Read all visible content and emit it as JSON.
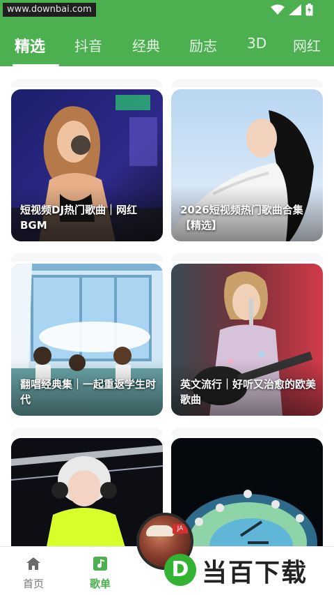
{
  "status_bar": {
    "watermark_url": "www.downbai.com",
    "icons": [
      "wifi-icon",
      "signal-icon",
      "battery-charging-icon"
    ]
  },
  "tabs": [
    {
      "label": "精选",
      "active": true
    },
    {
      "label": "抖音",
      "active": false
    },
    {
      "label": "经典",
      "active": false
    },
    {
      "label": "励志",
      "active": false
    },
    {
      "label": "3D",
      "active": false
    },
    {
      "label": "网红",
      "active": false
    }
  ],
  "cards": [
    {
      "title": "短视频DJ热门歌曲｜网红BGM"
    },
    {
      "title": "2026短视频热门歌曲合集【精选】"
    },
    {
      "title": "翻唱经典集｜一起重返学生时代"
    },
    {
      "title": "英文流行｜好听又治愈的欧美歌曲"
    },
    {
      "title": ""
    },
    {
      "title": ""
    }
  ],
  "bottom_nav": [
    {
      "label": "首页",
      "icon": "home-icon",
      "active": false
    },
    {
      "label": "歌单",
      "icon": "music-note-icon",
      "active": true
    }
  ],
  "mini_player": {
    "tag": "JA"
  },
  "brand": {
    "letter": "D",
    "text": "当百下载"
  },
  "colors": {
    "primary": "#4caf50",
    "nav_inactive": "#777777",
    "card_text": "#ffffff"
  }
}
